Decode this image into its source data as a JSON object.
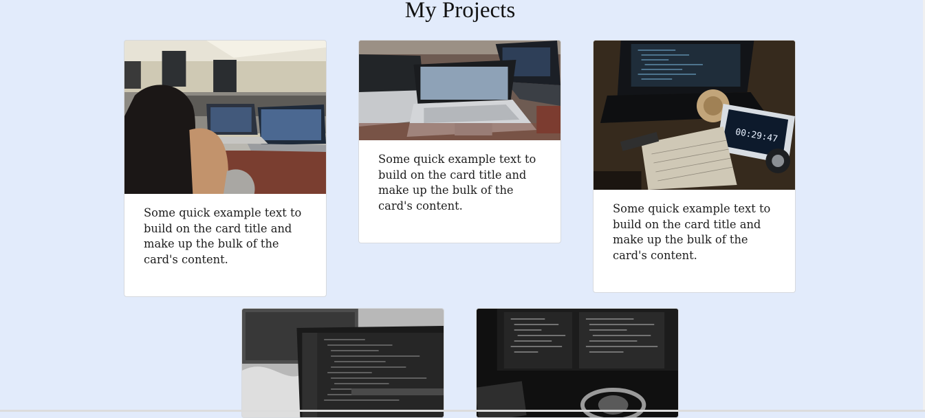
{
  "page": {
    "title": "My Projects"
  },
  "cards": [
    {
      "text": "Some quick example text to build on the card title and make up the bulk of the card's content."
    },
    {
      "text": "Some quick example text to build on the card title and make up the bulk of the card's content."
    },
    {
      "text": "Some quick example text to build on the card title and make up the bulk of the card's content."
    }
  ],
  "photos": {
    "timer_readout": "00:29:47"
  }
}
